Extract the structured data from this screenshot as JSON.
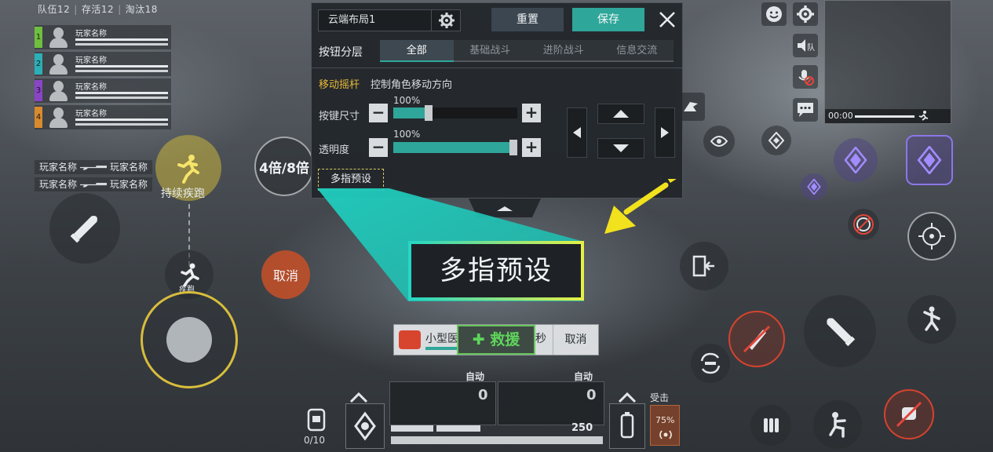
{
  "stats": {
    "team_label": "队伍12",
    "alive_label": "存活12",
    "eliminated_label": "淘汰18"
  },
  "team": [
    {
      "num": "1",
      "color": "#6fbf3e",
      "name": "玩家名称"
    },
    {
      "num": "2",
      "color": "#2ab0b6",
      "name": "玩家名称"
    },
    {
      "num": "3",
      "color": "#8a44c6",
      "name": "玩家名称"
    },
    {
      "num": "4",
      "color": "#d98a2c",
      "name": "玩家名称"
    }
  ],
  "killfeed": [
    {
      "killer": "玩家名称",
      "victim": "玩家名称"
    },
    {
      "killer": "玩家名称",
      "victim": "玩家名称"
    }
  ],
  "hud": {
    "sprint_label": "持续疾跑",
    "scope_label": "4倍/8倍",
    "crouch_label": "疾跑",
    "cancel_label": "取消",
    "timer": "00:00",
    "hit_label": "受击",
    "battery_pct": "75%",
    "ammo_count": "250",
    "grenade_count": "0/10",
    "auto_left": "自动",
    "auto_right": "自动",
    "zero_left": "0",
    "zero_right": "0"
  },
  "panel": {
    "layout_name": "云端布局1",
    "reset_label": "重置",
    "save_label": "保存",
    "layer_label": "按钮分层",
    "tabs": [
      {
        "label": "全部",
        "active": true
      },
      {
        "label": "基础战斗",
        "active": false
      },
      {
        "label": "进阶战斗",
        "active": false
      },
      {
        "label": "信息交流",
        "active": false
      }
    ],
    "item_title": "移动摇杆",
    "item_desc": "控制角色移动方向",
    "size_label": "按键尺寸",
    "size_pct": "100%",
    "size_value": 1.0,
    "opacity_label": "透明度",
    "opacity_pct": "100%",
    "opacity_value": 1.0,
    "multi_preset_label": "多指预设"
  },
  "callout": {
    "label": "多指预设",
    "accent_from": "#25d6c5",
    "accent_to": "#e6f046",
    "arrow_color": "#f2e11d"
  },
  "bottom": {
    "med_label": "小型医",
    "med_suffix": "秒",
    "med_cancel": "取消",
    "rescue_label": "救援"
  }
}
